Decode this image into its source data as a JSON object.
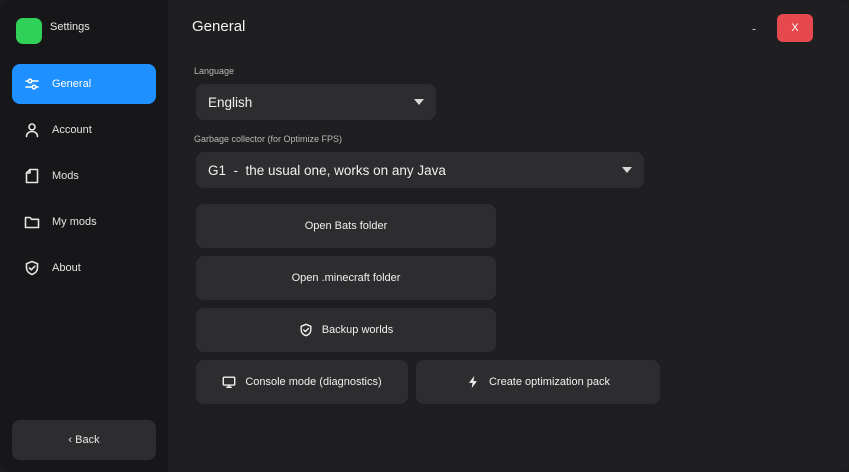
{
  "app": {
    "title": "Settings",
    "logo_color": "#30d158"
  },
  "sidebar": {
    "items": [
      {
        "label": "General",
        "icon": "sliders-icon",
        "active": true
      },
      {
        "label": "Account",
        "icon": "user-icon",
        "active": false
      },
      {
        "label": "Mods",
        "icon": "file-icon",
        "active": false
      },
      {
        "label": "My mods",
        "icon": "folder-icon",
        "active": false
      },
      {
        "label": "About",
        "icon": "shield-check-icon",
        "active": false
      }
    ],
    "back_label": "‹ Back",
    "accent_color": "#1e90ff"
  },
  "header": {
    "title": "General",
    "minimize_label": "-",
    "close_label": "X",
    "close_color": "#e5484d"
  },
  "main": {
    "language": {
      "label": "Language",
      "value": "English"
    },
    "gc": {
      "label": "Garbage collector (for Optimize FPS)",
      "value": "G1  -  the usual one, works on any Java"
    },
    "buttons": {
      "open_bats": "Open Bats folder",
      "open_minecraft": "Open .minecraft folder",
      "backup_worlds": "Backup worlds",
      "console_mode": "Console mode (diagnostics)",
      "create_pack": "Create optimization pack"
    }
  }
}
